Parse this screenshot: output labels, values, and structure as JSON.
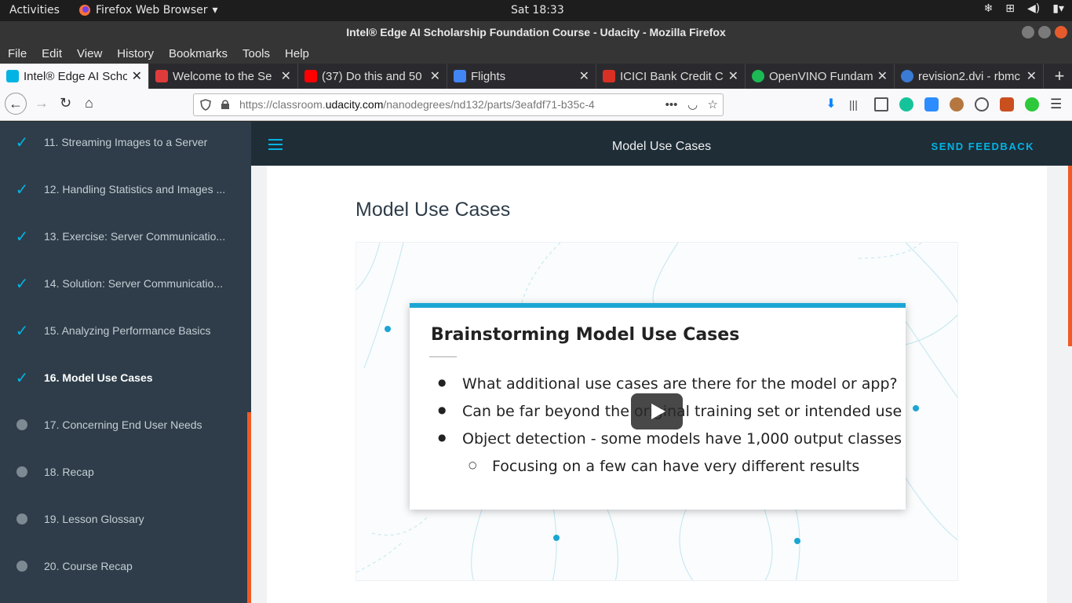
{
  "system": {
    "activities": "Activities",
    "app_name": "Firefox Web Browser",
    "clock": "Sat 18:33"
  },
  "window": {
    "title": "Intel® Edge AI Scholarship Foundation Course - Udacity - Mozilla Firefox"
  },
  "menu": [
    "File",
    "Edit",
    "View",
    "History",
    "Bookmarks",
    "Tools",
    "Help"
  ],
  "tabs": [
    {
      "title": "Intel® Edge AI Scho",
      "icon_color": "#02b3e4"
    },
    {
      "title": "Welcome to the Se",
      "icon_color": "#e03b3b"
    },
    {
      "title": "(37) Do this and 50",
      "icon_color": "#ff0000"
    },
    {
      "title": "Flights",
      "icon_color": "#4285f4"
    },
    {
      "title": "ICICI Bank Credit Ca",
      "icon_color": "#d93025"
    },
    {
      "title": "OpenVINO Fundam",
      "icon_color": "#1db954"
    },
    {
      "title": "revision2.dvi - rbmc",
      "icon_color": "#3a7bd5"
    }
  ],
  "url": {
    "prefix": "https://classroom.",
    "domain": "udacity.com",
    "path": "/nanodegrees/nd132/parts/3eafdf71-b35c-4"
  },
  "sidebar": {
    "items": [
      {
        "label": "11. Streaming Images to a Server",
        "done": true
      },
      {
        "label": "12. Handling Statistics and Images ...",
        "done": true
      },
      {
        "label": "13. Exercise: Server Communicatio...",
        "done": true
      },
      {
        "label": "14. Solution: Server Communicatio...",
        "done": true
      },
      {
        "label": "15. Analyzing Performance Basics",
        "done": true
      },
      {
        "label": "16. Model Use Cases",
        "done": true,
        "current": true
      },
      {
        "label": "17. Concerning End User Needs",
        "done": false
      },
      {
        "label": "18. Recap",
        "done": false
      },
      {
        "label": "19. Lesson Glossary",
        "done": false
      },
      {
        "label": "20. Course Recap",
        "done": false
      }
    ]
  },
  "header": {
    "title": "Model Use Cases",
    "feedback": "SEND FEEDBACK"
  },
  "page": {
    "heading": "Model Use Cases",
    "slide": {
      "title": "Brainstorming Model Use Cases",
      "bullets": [
        "What additional use cases are there for the model or app?",
        "Can be far beyond the original training set or intended use",
        "Object detection - some models have 1,000 output classes"
      ],
      "sub_bullet": "Focusing on a few can have very different results"
    }
  },
  "colors": {
    "accent": "#02b3e4",
    "orange": "#f15a24",
    "sidebar_bg": "#2e3d49",
    "header_bg": "#1f2d37"
  }
}
